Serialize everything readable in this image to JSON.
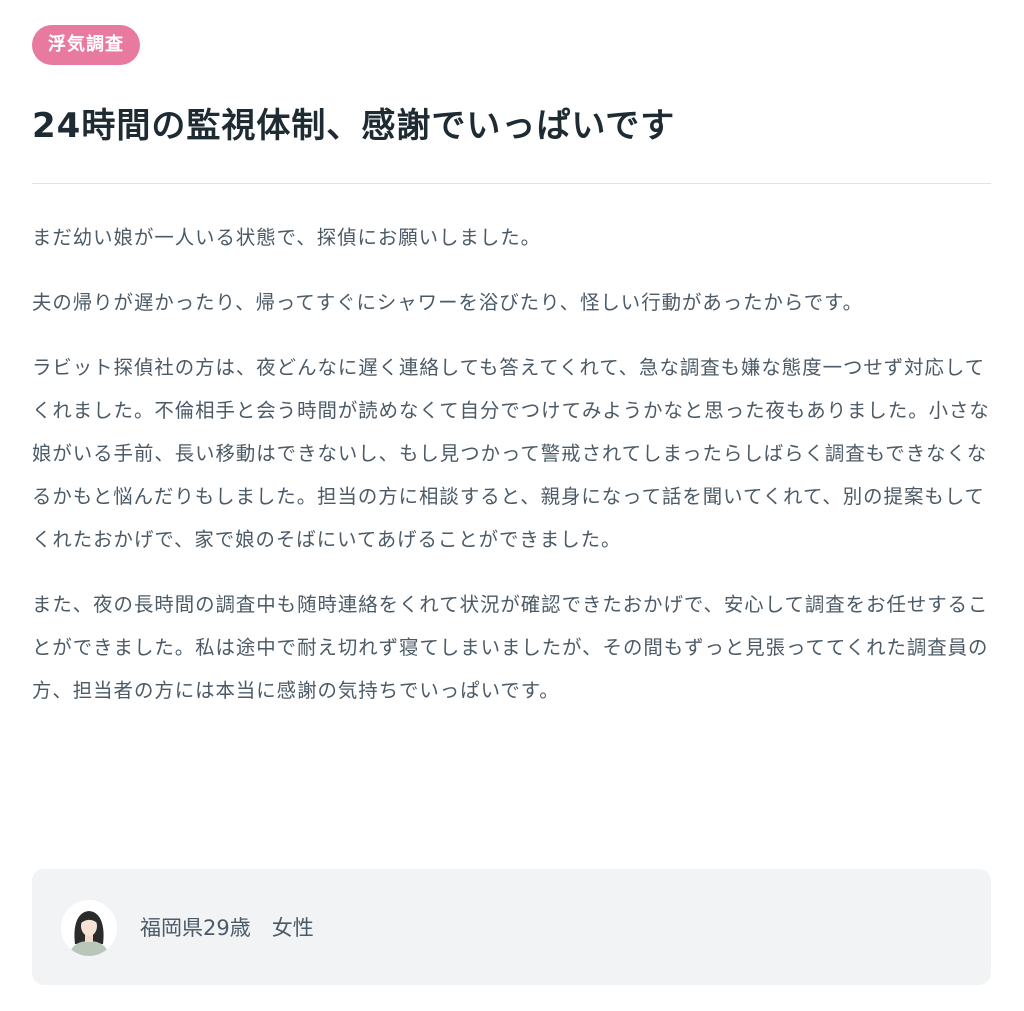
{
  "tag": {
    "label": "浮気調査",
    "color": "#e8799f"
  },
  "title": "24時間の監視体制、感謝でいっぱいです",
  "paragraphs": [
    "まだ幼い娘が一人いる状態で、探偵にお願いしました。",
    "夫の帰りが遅かったり、帰ってすぐにシャワーを浴びたり、怪しい行動があったからです。",
    "ラビット探偵社の方は、夜どんなに遅く連絡しても答えてくれて、急な調査も嫌な態度一つせず対応してくれました。不倫相手と会う時間が読めなくて自分でつけてみようかなと思った夜もありました。小さな娘がいる手前、長い移動はできないし、もし見つかって警戒されてしまったらしばらく調査もできなくなるかもと悩んだりもしました。担当の方に相談すると、親身になって話を聞いてくれて、別の提案もしてくれたおかげで、家で娘のそばにいてあげることができました。",
    "また、夜の長時間の調査中も随時連絡をくれて状況が確認できたおかげで、安心して調査をお任せすることができました。私は途中で耐え切れず寝てしまいましたが、その間もずっと見張っててくれた調査員の方、担当者の方には本当に感謝の気持ちでいっぱいです。"
  ],
  "profile": {
    "avatar_icon": "woman-avatar-icon",
    "text": "福岡県29歳　女性"
  }
}
